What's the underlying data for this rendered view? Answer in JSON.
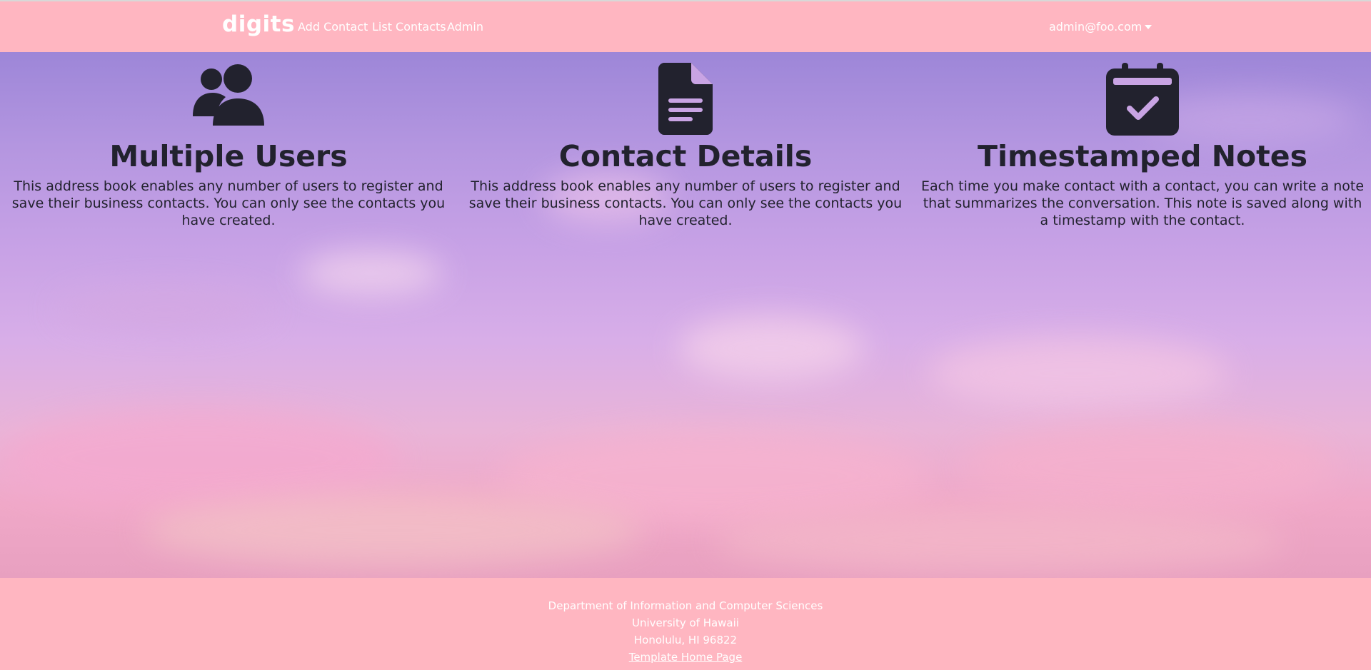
{
  "navbar": {
    "brand": "digits",
    "links": {
      "add_contact": "Add Contact",
      "list_contacts": "List Contacts",
      "admin": "Admin"
    },
    "user": "admin@foo.com"
  },
  "features": [
    {
      "icon": "users-icon",
      "title": "Multiple Users",
      "text": "This address book enables any number of users to register and save their business contacts. You can only see the contacts you have created."
    },
    {
      "icon": "file-lines-icon",
      "title": "Contact Details",
      "text": "This address book enables any number of users to register and save their business contacts. You can only see the contacts you have created."
    },
    {
      "icon": "calendar-check-icon",
      "title": "Timestamped Notes",
      "text": "Each time you make contact with a contact, you can write a note that summarizes the conversation. This note is saved along with a timestamp with the contact."
    }
  ],
  "footer": {
    "line1": "Department of Information and Computer Sciences",
    "line2": "University of Hawaii",
    "line3": "Honolulu, HI 96822",
    "link": "Template Home Page"
  },
  "colors": {
    "navbar_bg": "#ffb6c1",
    "text_dark": "#22222e",
    "nav_text": "#ffffff"
  }
}
